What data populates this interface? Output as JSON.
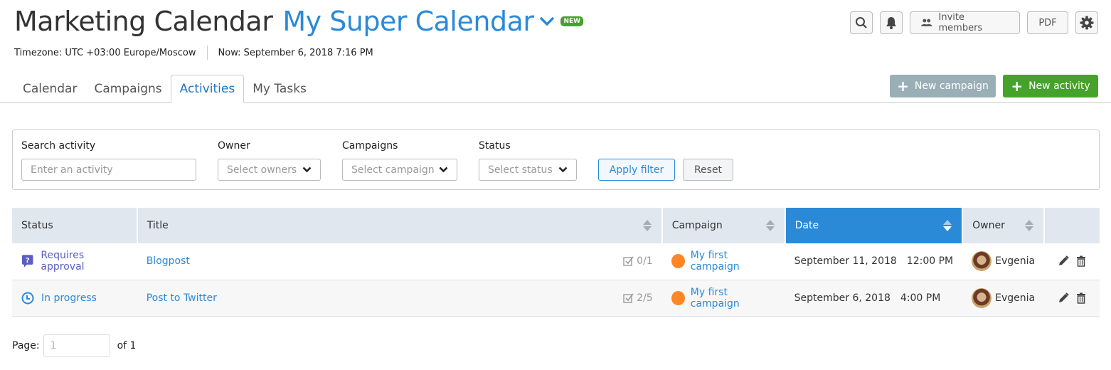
{
  "header": {
    "app_title": "Marketing Calendar",
    "calendar_name": "My Super Calendar",
    "new_badge": "NEW",
    "timezone": "Timezone: UTC +03:00 Europe/Moscow",
    "now": "Now: September 6, 2018 7:16 PM",
    "icons": {
      "search": "search-icon",
      "bell": "bell-icon",
      "invite": "users-icon",
      "settings": "gear-icon",
      "chevron": "chevron-down-icon"
    },
    "invite_label": "Invite members",
    "pdf_label": "PDF"
  },
  "tabs": [
    {
      "label": "Calendar",
      "active": false
    },
    {
      "label": "Campaigns",
      "active": false
    },
    {
      "label": "Activities",
      "active": true
    },
    {
      "label": "My Tasks",
      "active": false
    }
  ],
  "actions": {
    "new_campaign": "New campaign",
    "new_activity": "New activity"
  },
  "filters": {
    "search_label": "Search activity",
    "search_placeholder": "Enter an activity",
    "search_value": "",
    "owner_label": "Owner",
    "owner_placeholder": "Select owners",
    "campaigns_label": "Campaigns",
    "campaigns_placeholder": "Select campaign",
    "status_label": "Status",
    "status_placeholder": "Select status",
    "apply_label": "Apply filter",
    "reset_label": "Reset"
  },
  "table": {
    "columns": [
      "Status",
      "Title",
      "Campaign",
      "Date",
      "Owner",
      ""
    ],
    "sorted_column": "Date",
    "rows": [
      {
        "status": "Requires approval",
        "status_icon": "question-bubble-icon",
        "title": "Blogpost",
        "tasks": "0/1",
        "campaign": "My first campaign",
        "campaign_color": "#ff8625",
        "date": "September 11, 2018",
        "time": "12:00 PM",
        "owner": "Evgenia"
      },
      {
        "status": "In progress",
        "status_icon": "clock-icon",
        "title": "Post to Twitter",
        "tasks": "2/5",
        "campaign": "My first campaign",
        "campaign_color": "#ff8625",
        "date": "September 6, 2018",
        "time": "4:00 PM",
        "owner": "Evgenia"
      }
    ]
  },
  "pagination": {
    "label": "Page:",
    "current": "1",
    "of": "of 1"
  },
  "colors": {
    "accent": "#2b8ad8",
    "green": "#45a32c",
    "approval": "#5b5ec1",
    "header_bg": "#e0e7ef"
  }
}
